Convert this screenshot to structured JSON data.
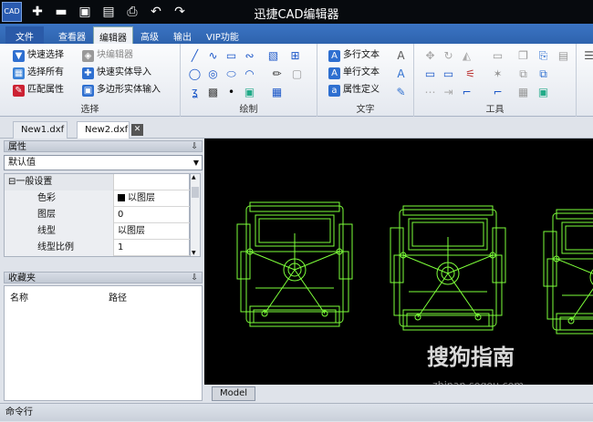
{
  "window": {
    "title": "迅捷CAD编辑器",
    "logo_text": "CAD"
  },
  "menu_tabs": [
    "文件",
    "查看器",
    "编辑器",
    "高级",
    "输出",
    "VIP功能"
  ],
  "ribbon": {
    "select_group": {
      "label": "选择",
      "buttons": [
        "快速选择",
        "选择所有",
        "匹配属性",
        "块编辑器",
        "快速实体导入",
        "多边形实体输入"
      ]
    },
    "draw_group": {
      "label": "绘制"
    },
    "text_group": {
      "label": "文字",
      "buttons": [
        "多行文本",
        "单行文本",
        "属性定义"
      ]
    },
    "tools_group": {
      "label": "工具"
    }
  },
  "doc_tabs": [
    "New1.dxf",
    "New2.dxf"
  ],
  "properties_panel": {
    "title": "属性",
    "pin": "⇩",
    "dropdown_value": "默认值",
    "section": "一般设置",
    "rows": [
      {
        "k": "色彩",
        "v": "以图层"
      },
      {
        "k": "图层",
        "v": "0"
      },
      {
        "k": "线型",
        "v": "以图层"
      },
      {
        "k": "线型比例",
        "v": "1"
      }
    ]
  },
  "favorites_panel": {
    "title": "收藏夹",
    "pin": "⇩",
    "columns": [
      "名称",
      "路径"
    ]
  },
  "model_tab": "Model",
  "command_line": "命令行",
  "watermark": {
    "brand": "搜狗指南",
    "url": "zhinan.sogou.com"
  },
  "colors": {
    "accent": "#2e63ad",
    "cad_lines": "#7dff3a",
    "canvas": "#000000"
  }
}
